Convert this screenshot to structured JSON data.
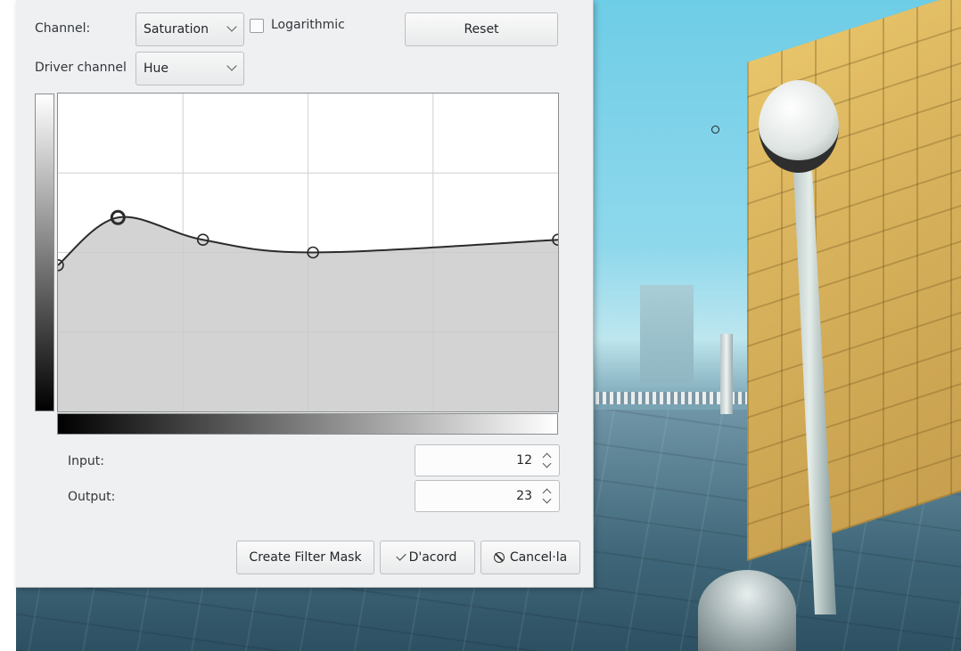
{
  "dialog": {
    "channel_label": "Channel:",
    "channel_value": "Saturation",
    "logarithmic_label": "Logarithmic",
    "logarithmic_checked": false,
    "reset_label": "Reset",
    "driver_channel_label": "Driver channel",
    "driver_channel_value": "Hue",
    "input_label": "Input:",
    "input_value": "12",
    "output_label": "Output:",
    "output_value": "23",
    "create_filter_mask_label": "Create Filter Mask",
    "ok_label": "D'acord",
    "cancel_label": "Cancel·la"
  },
  "curve": {
    "control_points": [
      {
        "input": 0,
        "output": 46
      },
      {
        "input": 12,
        "output": 61
      },
      {
        "input": 29,
        "output": 54
      },
      {
        "input": 51,
        "output": 50
      },
      {
        "input": 100,
        "output": 54
      }
    ],
    "selected_index": 1,
    "input_range": [
      0,
      100
    ],
    "output_range": [
      0,
      100
    ],
    "grid": true,
    "colors": {
      "fill": "#d3d3d3",
      "curve": "#2b2b2b",
      "grid": "#e2e2e2"
    }
  }
}
